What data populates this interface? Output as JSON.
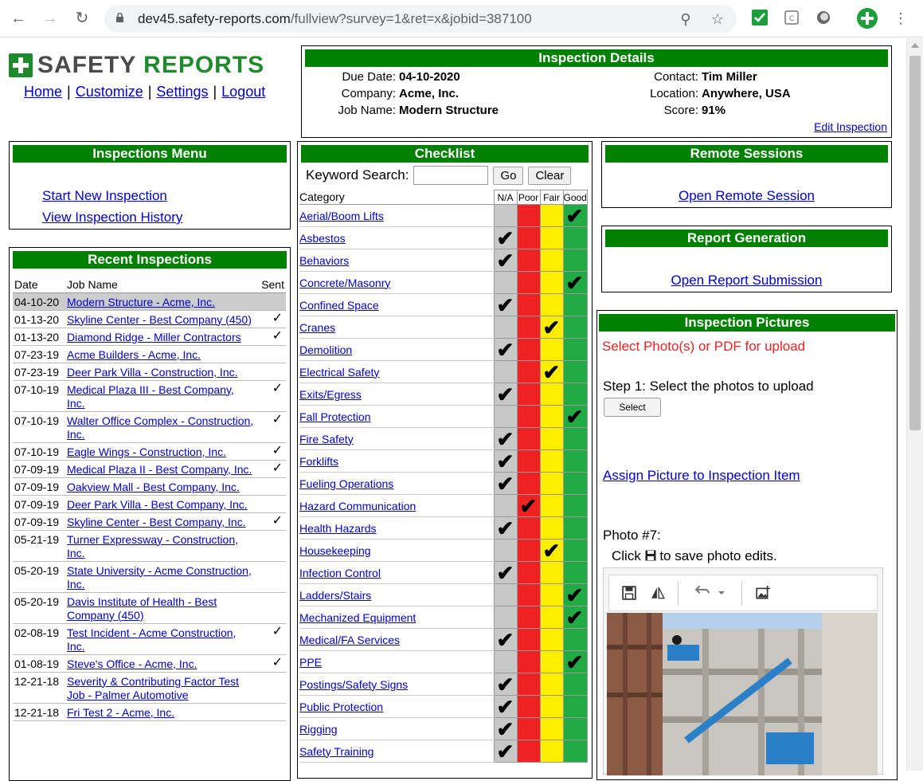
{
  "browser": {
    "url_host": "dev45.safety-reports.com",
    "url_path": "/fullview?survey=1&ret=x&jobid=387100"
  },
  "logo": {
    "part1": "SAFETY",
    "part2": "REPORTS"
  },
  "topnav": {
    "home": "Home",
    "customize": "Customize",
    "settings": "Settings",
    "logout": "Logout",
    "sep": "|"
  },
  "details": {
    "title": "Inspection Details",
    "due_date_label": "Due Date:",
    "due_date": "04-10-2020",
    "company_label": "Company:",
    "company": "Acme, Inc.",
    "job_label": "Job Name:",
    "job": "Modern Structure",
    "contact_label": "Contact:",
    "contact": "Tim Miller",
    "location_label": "Location:",
    "location": "Anywhere, USA",
    "score_label": "Score:",
    "score": "91%",
    "edit_link": "Edit Inspection"
  },
  "menu": {
    "title": "Inspections Menu",
    "start": "Start New Inspection",
    "history": "View Inspection History"
  },
  "recent": {
    "title": "Recent Inspections",
    "col_date": "Date",
    "col_job": "Job Name",
    "col_sent": "Sent",
    "rows": [
      {
        "date": "04-10-20",
        "job": "Modern Structure - Acme, Inc.",
        "sent": ""
      },
      {
        "date": "01-13-20",
        "job": "Skyline Center - Best Company (450)",
        "sent": "✓"
      },
      {
        "date": "01-13-20",
        "job": "Diamond Ridge - Miller Contractors",
        "sent": "✓"
      },
      {
        "date": "07-23-19",
        "job": "Acme Builders - Acme, Inc.",
        "sent": ""
      },
      {
        "date": "07-23-19",
        "job": "Deer Park Villa - Construction, Inc.",
        "sent": ""
      },
      {
        "date": "07-10-19",
        "job": "Medical Plaza III - Best Company, Inc.",
        "sent": "✓"
      },
      {
        "date": "07-10-19",
        "job": "Walter Office Complex - Construction, Inc.",
        "sent": "✓"
      },
      {
        "date": "07-10-19",
        "job": "Eagle Wings - Construction, Inc.",
        "sent": "✓"
      },
      {
        "date": "07-09-19",
        "job": "Medical Plaza II - Best Company, Inc.",
        "sent": "✓"
      },
      {
        "date": "07-09-19",
        "job": "Oakview Mall - Best Company, Inc.",
        "sent": ""
      },
      {
        "date": "07-09-19",
        "job": "Deer Park Villa - Best Company, Inc.",
        "sent": ""
      },
      {
        "date": "07-09-19",
        "job": "Skyline Center - Best Company, Inc.",
        "sent": "✓"
      },
      {
        "date": "05-21-19",
        "job": "Turner Expressway - Construction, Inc.",
        "sent": ""
      },
      {
        "date": "05-20-19",
        "job": "State University - Acme Construction, Inc.",
        "sent": ""
      },
      {
        "date": "05-20-19",
        "job": "Davis Institute of Health - Best Company (450)",
        "sent": ""
      },
      {
        "date": "02-08-19",
        "job": "Test Incident - Acme Construction, Inc.",
        "sent": "✓"
      },
      {
        "date": "01-08-19",
        "job": "Steve's Office - Acme, Inc.",
        "sent": "✓"
      },
      {
        "date": "12-21-18",
        "job": "Severity & Contributing Factor Test Job - Palmer Automotive",
        "sent": ""
      },
      {
        "date": "12-21-18",
        "job": "Fri Test 2 - Acme, Inc.",
        "sent": ""
      }
    ]
  },
  "checklist": {
    "title": "Checklist",
    "search_label": "Keyword Search:",
    "go": "Go",
    "clear": "Clear",
    "col_category": "Category",
    "col_na": "N/A",
    "col_poor": "Poor",
    "col_fair": "Fair",
    "col_good": "Good",
    "check_glyph": "✔",
    "items": [
      {
        "name": "Aerial/Boom Lifts",
        "rating": "good"
      },
      {
        "name": "Asbestos",
        "rating": "na"
      },
      {
        "name": "Behaviors",
        "rating": "na"
      },
      {
        "name": "Concrete/Masonry",
        "rating": "good"
      },
      {
        "name": "Confined Space",
        "rating": "na"
      },
      {
        "name": "Cranes",
        "rating": "fair"
      },
      {
        "name": "Demolition",
        "rating": "na"
      },
      {
        "name": "Electrical Safety",
        "rating": "fair"
      },
      {
        "name": "Exits/Egress",
        "rating": "na"
      },
      {
        "name": "Fall Protection",
        "rating": "good"
      },
      {
        "name": "Fire Safety",
        "rating": "na"
      },
      {
        "name": "Forklifts",
        "rating": "na"
      },
      {
        "name": "Fueling Operations",
        "rating": "na"
      },
      {
        "name": "Hazard Communication",
        "rating": "poor"
      },
      {
        "name": "Health Hazards",
        "rating": "na"
      },
      {
        "name": "Housekeeping",
        "rating": "fair"
      },
      {
        "name": "Infection Control",
        "rating": "na"
      },
      {
        "name": "Ladders/Stairs",
        "rating": "good"
      },
      {
        "name": "Mechanized Equipment",
        "rating": "good"
      },
      {
        "name": "Medical/FA Services",
        "rating": "na"
      },
      {
        "name": "PPE",
        "rating": "good"
      },
      {
        "name": "Postings/Safety Signs",
        "rating": "na"
      },
      {
        "name": "Public Protection",
        "rating": "na"
      },
      {
        "name": "Rigging",
        "rating": "na"
      },
      {
        "name": "Safety Training",
        "rating": "na"
      }
    ]
  },
  "remote": {
    "title": "Remote Sessions",
    "link": "Open Remote Session"
  },
  "report": {
    "title": "Report Generation",
    "link": "Open Report Submission"
  },
  "pictures": {
    "title": "Inspection Pictures",
    "prompt": "Select Photo(s) or PDF for upload",
    "step1": "Step 1: Select the photos to upload",
    "select_btn": "Select",
    "assign_link": "Assign Picture to Inspection Item",
    "photo_label": "Photo #7:",
    "save_hint_pre": "Click",
    "save_hint_post": "to save photo edits."
  },
  "colors": {
    "header_green": "#008000",
    "link_blue": "#0000cc",
    "poor": "#ee2222",
    "fair": "#ffee00",
    "good": "#22aa44",
    "na": "#c8c8c8"
  }
}
